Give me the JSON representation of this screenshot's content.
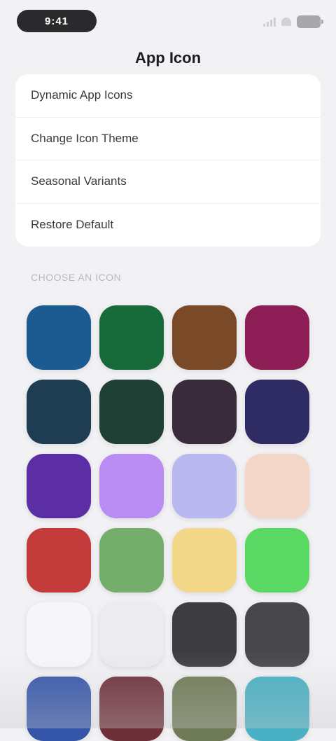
{
  "status_bar": {
    "time": "9:41"
  },
  "header": {
    "title": "App Icon"
  },
  "settings": {
    "rows": [
      {
        "label": "Dynamic App Icons"
      },
      {
        "label": "Change Icon Theme"
      },
      {
        "label": "Seasonal Variants"
      },
      {
        "label": "Restore Default"
      }
    ]
  },
  "icons": {
    "section_label": "Choose an icon",
    "tiles": [
      {
        "name": "icon-blue",
        "color": "#1c5b92"
      },
      {
        "name": "icon-green",
        "color": "#176a39"
      },
      {
        "name": "icon-brown",
        "color": "#7a4a28"
      },
      {
        "name": "icon-magenta",
        "color": "#8c1d55"
      },
      {
        "name": "icon-dark-teal",
        "color": "#1e3d52"
      },
      {
        "name": "icon-dark-green",
        "color": "#1f4034"
      },
      {
        "name": "icon-dark-plum",
        "color": "#3a2b3c"
      },
      {
        "name": "icon-navy-purple",
        "color": "#2f2c63"
      },
      {
        "name": "icon-purple",
        "color": "#5b2ea6"
      },
      {
        "name": "icon-lavender",
        "color": "#b98cf4"
      },
      {
        "name": "icon-iridescent",
        "color": "#b9b7ef"
      },
      {
        "name": "icon-peach",
        "color": "#f3d6c8"
      },
      {
        "name": "icon-red",
        "color": "#c23a3a"
      },
      {
        "name": "icon-sage",
        "color": "#74ad6c"
      },
      {
        "name": "icon-yellow",
        "color": "#f2d888"
      },
      {
        "name": "icon-lime",
        "color": "#59d864"
      },
      {
        "name": "icon-white",
        "color": "#f7f7f9"
      },
      {
        "name": "icon-light-gray",
        "color": "#ececf0"
      },
      {
        "name": "icon-charcoal",
        "color": "#3d3d40"
      },
      {
        "name": "icon-dark-gray",
        "color": "#48484c"
      },
      {
        "name": "icon-royal-blue",
        "color": "#3556a8"
      },
      {
        "name": "icon-maroon",
        "color": "#6e3038"
      },
      {
        "name": "icon-olive",
        "color": "#6e7a55"
      },
      {
        "name": "icon-teal",
        "color": "#48b0c2"
      }
    ]
  }
}
